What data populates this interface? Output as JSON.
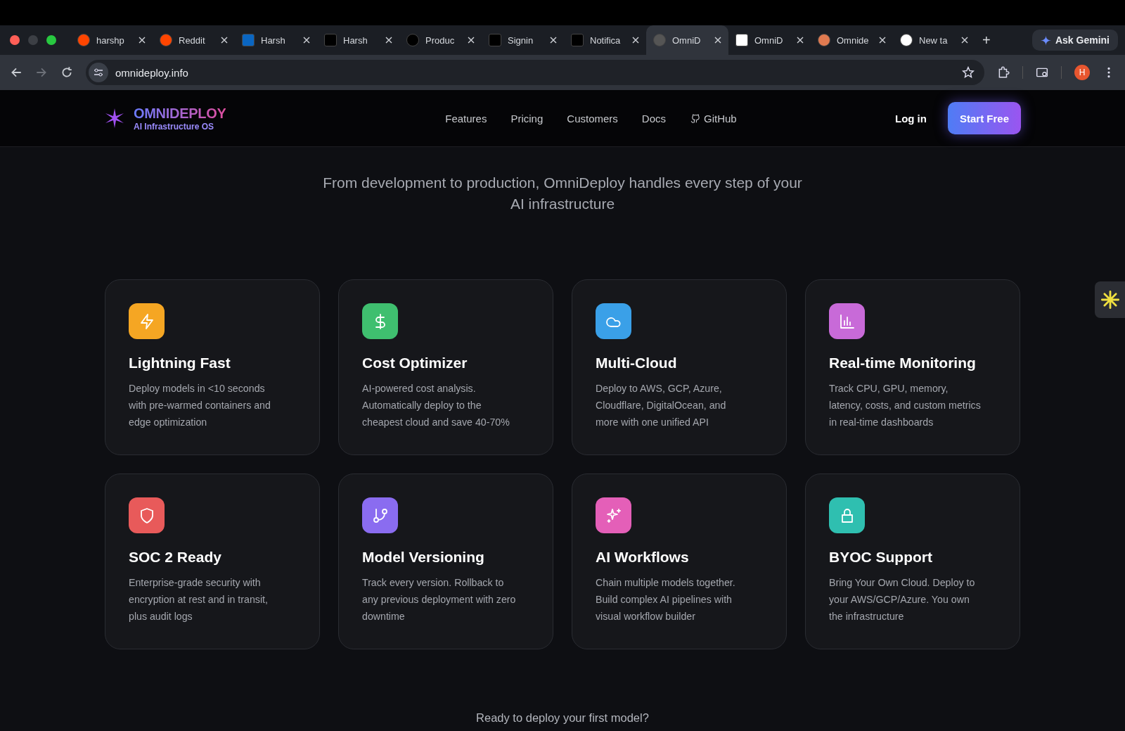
{
  "browser": {
    "tabs": [
      {
        "label": "harshp",
        "selected": false
      },
      {
        "label": "Reddit",
        "selected": false
      },
      {
        "label": "Harsh",
        "selected": false
      },
      {
        "label": "Harsh",
        "selected": false
      },
      {
        "label": "Produc",
        "selected": false
      },
      {
        "label": "Signin",
        "selected": false
      },
      {
        "label": "Notifica",
        "selected": false
      },
      {
        "label": "OmniD",
        "selected": true
      },
      {
        "label": "OmniD",
        "selected": false
      },
      {
        "label": "Omnide",
        "selected": false
      },
      {
        "label": "New ta",
        "selected": false
      }
    ],
    "new_tab": "+",
    "gemini": "Ask Gemini",
    "url": "omnideploy.info",
    "avatar": "H"
  },
  "header": {
    "brand": "OMNIDEPLOY",
    "tagline": "AI Infrastructure OS",
    "nav": [
      "Features",
      "Pricing",
      "Customers",
      "Docs",
      "GitHub"
    ],
    "login": "Log in",
    "cta": "Start Free"
  },
  "subtitle": "From development to production, OmniDeploy handles every step of your AI infrastructure",
  "features": [
    {
      "title": "Lightning Fast",
      "text": "Deploy models in <10 seconds with pre-warmed containers and edge optimization",
      "color": "#f5a623"
    },
    {
      "title": "Cost Optimizer",
      "text": "AI-powered cost analysis. Automatically deploy to the cheapest cloud and save 40-70%",
      "color": "#3fbf6f"
    },
    {
      "title": "Multi-Cloud",
      "text": "Deploy to AWS, GCP, Azure, Cloudflare, DigitalOcean, and more with one unified API",
      "color": "#3aa0e8"
    },
    {
      "title": "Real-time Monitoring",
      "text": "Track CPU, GPU, memory, latency, costs, and custom metrics in real-time dashboards",
      "color": "#c86ad8"
    },
    {
      "title": "SOC 2 Ready",
      "text": "Enterprise-grade security with encryption at rest and in transit, plus audit logs",
      "color": "#e85a5a"
    },
    {
      "title": "Model Versioning",
      "text": "Track every version. Rollback to any previous deployment with zero downtime",
      "color": "#8a6cf0"
    },
    {
      "title": "AI Workflows",
      "text": "Chain multiple models together. Build complex AI pipelines with visual workflow builder",
      "color": "#e45fb8"
    },
    {
      "title": "BYOC Support",
      "text": "Bring Your Own Cloud. Deploy to your AWS/GCP/Azure. You own the infrastructure",
      "color": "#2fbfb0"
    }
  ],
  "cta_text": "Ready to deploy your first model?"
}
